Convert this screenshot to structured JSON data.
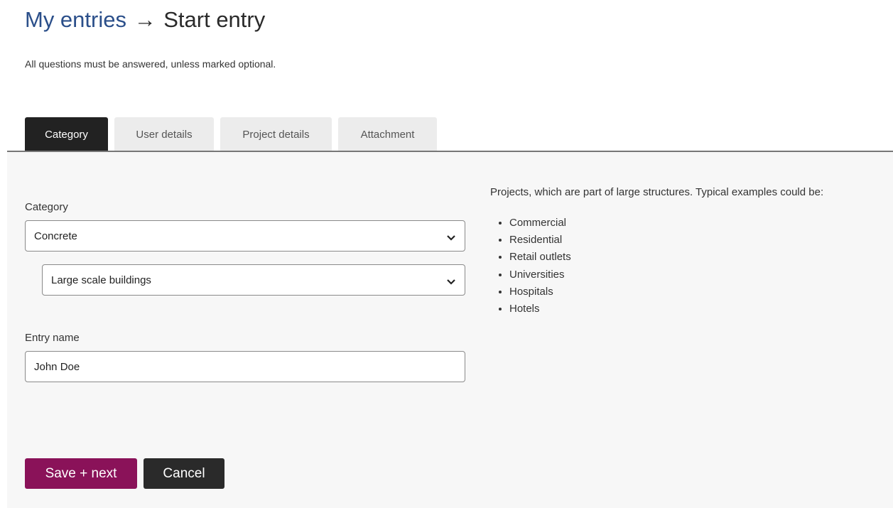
{
  "header": {
    "breadcrumb_link": "My entries",
    "arrow": "→",
    "current_page": "Start entry"
  },
  "intro_text": "All questions must be answered, unless marked optional.",
  "tabs": [
    {
      "label": "Category",
      "active": true
    },
    {
      "label": "User details",
      "active": false
    },
    {
      "label": "Project details",
      "active": false
    },
    {
      "label": "Attachment",
      "active": false
    }
  ],
  "form": {
    "category_label": "Category",
    "category_value": "Concrete",
    "subcategory_value": "Large scale buildings",
    "entry_name_label": "Entry name",
    "entry_name_value": "John Doe"
  },
  "help": {
    "text": "Projects, which are part of large structures. Typical examples could be:",
    "examples": [
      "Commercial",
      "Residential",
      "Retail outlets",
      "Universities",
      "Hospitals",
      "Hotels"
    ]
  },
  "actions": {
    "save_label": "Save + next",
    "cancel_label": "Cancel"
  },
  "colors": {
    "primary_button": "#8a1259",
    "secondary_button": "#2a2a2a",
    "active_tab": "#222222",
    "breadcrumb_link": "#2b4f8a"
  },
  "icons": {
    "select_chevron": "chevron-down-icon"
  }
}
